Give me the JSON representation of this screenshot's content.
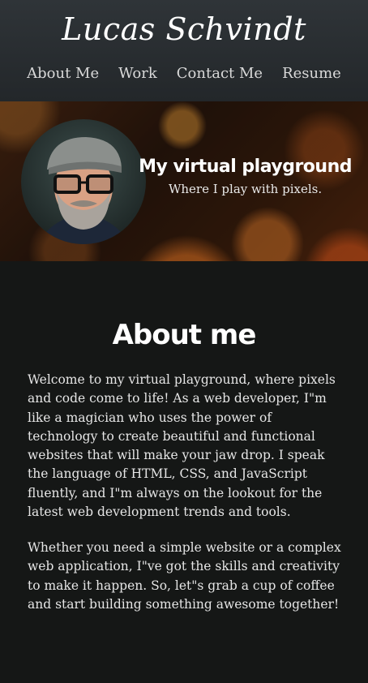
{
  "header": {
    "logo": "Lucas Schvindt",
    "nav": [
      "About Me",
      "Work",
      "Contact Me",
      "Resume"
    ]
  },
  "hero": {
    "title": "My virtual playground",
    "subtitle": "Where I play with pixels."
  },
  "about": {
    "title": "About me",
    "paragraphs": [
      "Welcome to my virtual playground, where pixels and code come to life! As a web developer, I\"m like a magician who uses the power of technology to create beautiful and functional websites that will make your jaw drop. I speak the language of HTML, CSS, and JavaScript fluently, and I\"m always on the lookout for the latest web development trends and tools.",
      "Whether you need a simple website or a complex web application, I\"ve got the skills and creativity to make it happen. So, let\"s grab a cup of coffee and start building something awesome together!"
    ]
  }
}
